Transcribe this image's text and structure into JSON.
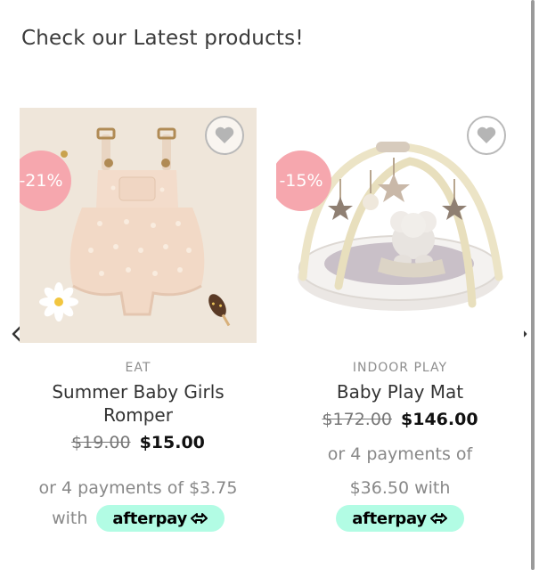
{
  "section": {
    "title": "Check our Latest products!"
  },
  "products": [
    {
      "badge": "-21%",
      "category": "EAT",
      "title_line1": "Summer Baby Girls",
      "title_line2": "Romper",
      "old_price": "$19.00",
      "new_price": "$15.00",
      "installments_line1": "or 4 payments of $3.75",
      "with_text": "with",
      "afterpay_label": "afterpay"
    },
    {
      "badge": "-15%",
      "category": "INDOOR PLAY",
      "title": "Baby Play Mat",
      "old_price": "$172.00",
      "new_price": "$146.00",
      "installments_line1": "or 4 payments of",
      "installments_line2": "$36.50 with",
      "afterpay_label": "afterpay"
    }
  ],
  "colors": {
    "badge": "#f6a7ae",
    "afterpay": "#b2fce4"
  },
  "icons": {
    "wishlist": "heart-icon",
    "prev": "chevron-left-icon",
    "next": "chevron-right-icon"
  }
}
